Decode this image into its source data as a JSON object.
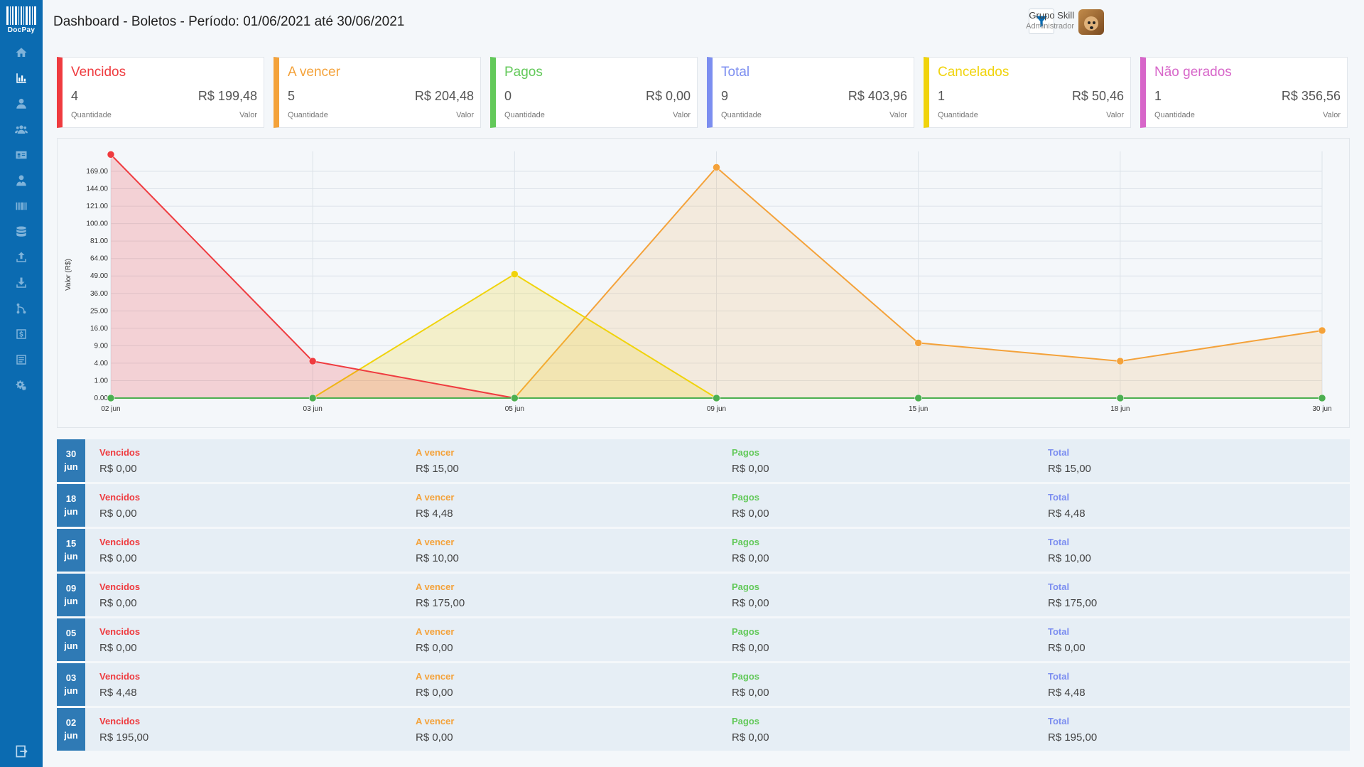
{
  "app": {
    "logo_text": "DocPay",
    "title": "Dashboard - Boletos - Período: 01/06/2021 até 30/06/2021"
  },
  "sidebar": {
    "items": [
      {
        "icon": "home-icon"
      },
      {
        "icon": "bar-chart-icon",
        "active": true
      },
      {
        "icon": "user-icon"
      },
      {
        "icon": "users-icon"
      },
      {
        "icon": "id-card-icon"
      },
      {
        "icon": "user-tie-icon"
      },
      {
        "icon": "barcode-icon"
      },
      {
        "icon": "database-icon"
      },
      {
        "icon": "upload-icon"
      },
      {
        "icon": "download-icon"
      },
      {
        "icon": "code-branch-icon"
      },
      {
        "icon": "dollar-icon"
      },
      {
        "icon": "list-icon"
      },
      {
        "icon": "cogs-icon"
      }
    ],
    "logout_icon": "sign-out-icon"
  },
  "header": {
    "user_name": "Grupo Skill",
    "user_role": "Administrador"
  },
  "cards": [
    {
      "title": "Vencidos",
      "quantity": "4",
      "value": "R$ 199,48",
      "color": "#ef3b3f"
    },
    {
      "title": "A vencer",
      "quantity": "5",
      "value": "R$ 204,48",
      "color": "#f4a23a"
    },
    {
      "title": "Pagos",
      "quantity": "0",
      "value": "R$ 0,00",
      "color": "#63c95a"
    },
    {
      "title": "Total",
      "quantity": "9",
      "value": "R$ 403,96",
      "color": "#7c8ef0"
    },
    {
      "title": "Cancelados",
      "quantity": "1",
      "value": "R$ 50,46",
      "color": "#f0d30b"
    },
    {
      "title": "Não gerados",
      "quantity": "1",
      "value": "R$ 356,56",
      "color": "#d766c9"
    }
  ],
  "card_labels": {
    "quantity": "Quantidade",
    "value": "Valor"
  },
  "chart_data": {
    "type": "area",
    "ylabel": "Valor (R$)",
    "y_scale": "sqrt",
    "yticks": [
      0,
      1,
      4,
      9,
      16,
      25,
      36,
      49,
      64,
      81,
      100,
      121,
      144,
      169
    ],
    "ytick_labels": [
      "0.00",
      "1.00",
      "4.00",
      "9.00",
      "16.00",
      "25.00",
      "36.00",
      "49.00",
      "64.00",
      "81.00",
      "100.00",
      "121.00",
      "144.00",
      "169.00"
    ],
    "categories": [
      "02 jun",
      "03 jun",
      "05 jun",
      "09 jun",
      "15 jun",
      "18 jun",
      "30 jun"
    ],
    "series": [
      {
        "name": "Vencidos",
        "color": "#ef3b3f",
        "values": [
          195,
          4.48,
          0,
          0,
          0,
          0,
          0
        ]
      },
      {
        "name": "A vencer",
        "color": "#f4a23a",
        "values": [
          0,
          0,
          0,
          175,
          10,
          4.48,
          15
        ]
      },
      {
        "name": "Pagos",
        "color": "#4caf50",
        "values": [
          0,
          0,
          0,
          0,
          0,
          0,
          0
        ]
      },
      {
        "name": "Cancelados",
        "color": "#f0d30b",
        "values": [
          0,
          0,
          50.46,
          0,
          0,
          0,
          0
        ]
      }
    ],
    "grid": true
  },
  "rows": [
    {
      "day": "30",
      "month": "jun",
      "vencidos": "R$ 0,00",
      "a_vencer": "R$ 15,00",
      "pagos": "R$ 0,00",
      "total": "R$ 15,00"
    },
    {
      "day": "18",
      "month": "jun",
      "vencidos": "R$ 0,00",
      "a_vencer": "R$ 4,48",
      "pagos": "R$ 0,00",
      "total": "R$ 4,48"
    },
    {
      "day": "15",
      "month": "jun",
      "vencidos": "R$ 0,00",
      "a_vencer": "R$ 10,00",
      "pagos": "R$ 0,00",
      "total": "R$ 10,00"
    },
    {
      "day": "09",
      "month": "jun",
      "vencidos": "R$ 0,00",
      "a_vencer": "R$ 175,00",
      "pagos": "R$ 0,00",
      "total": "R$ 175,00"
    },
    {
      "day": "05",
      "month": "jun",
      "vencidos": "R$ 0,00",
      "a_vencer": "R$ 0,00",
      "pagos": "R$ 0,00",
      "total": "R$ 0,00"
    },
    {
      "day": "03",
      "month": "jun",
      "vencidos": "R$ 4,48",
      "a_vencer": "R$ 0,00",
      "pagos": "R$ 0,00",
      "total": "R$ 4,48"
    },
    {
      "day": "02",
      "month": "jun",
      "vencidos": "R$ 195,00",
      "a_vencer": "R$ 0,00",
      "pagos": "R$ 0,00",
      "total": "R$ 195,00"
    }
  ],
  "row_labels": {
    "vencidos": "Vencidos",
    "a_vencer": "A vencer",
    "pagos": "Pagos",
    "total": "Total"
  },
  "row_colors": {
    "vencidos": "#ef3b3f",
    "a_vencer": "#f4a23a",
    "pagos": "#63c95a",
    "total": "#7c8ef0"
  }
}
